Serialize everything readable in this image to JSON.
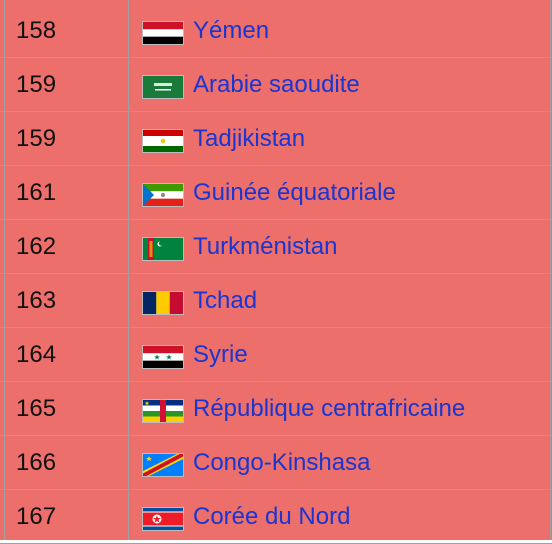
{
  "rows": [
    {
      "rank": "158",
      "country": "Yémen",
      "flag": "yemen-flag-icon"
    },
    {
      "rank": "159",
      "country": "Arabie saoudite",
      "flag": "saudi-arabia-flag-icon"
    },
    {
      "rank": "159",
      "country": "Tadjikistan",
      "flag": "tajikistan-flag-icon"
    },
    {
      "rank": "161",
      "country": "Guinée équatoriale",
      "flag": "equatorial-guinea-flag-icon"
    },
    {
      "rank": "162",
      "country": "Turkménistan",
      "flag": "turkmenistan-flag-icon"
    },
    {
      "rank": "163",
      "country": "Tchad",
      "flag": "chad-flag-icon"
    },
    {
      "rank": "164",
      "country": "Syrie",
      "flag": "syria-flag-icon"
    },
    {
      "rank": "165",
      "country": "République centrafricaine",
      "flag": "central-african-republic-flag-icon"
    },
    {
      "rank": "166",
      "country": "Congo-Kinshasa",
      "flag": "dr-congo-flag-icon"
    },
    {
      "rank": "167",
      "country": "Corée du Nord",
      "flag": "north-korea-flag-icon"
    }
  ],
  "colors": {
    "row_background": "#ec6f6b",
    "link": "#1a35d0",
    "border": "#a0a0a0"
  }
}
